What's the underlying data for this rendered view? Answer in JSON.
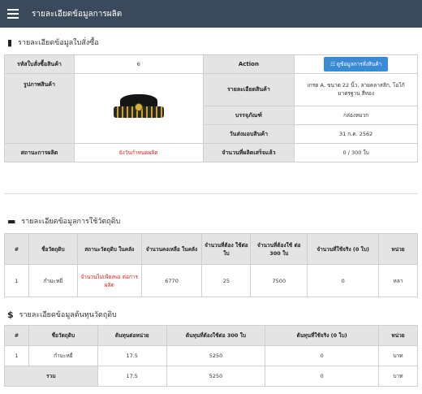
{
  "header": {
    "title": "รายละเอียดข้อมูลการผลิต",
    "menu_icon": "hamburger-icon"
  },
  "order_section": {
    "title": "รายละเอียดข้อมูลใบสั่งซื้อ",
    "icon": "document-icon",
    "order_id_label": "รหัสใบสั่งซื้อสินค้า",
    "order_id_value": "6",
    "action_label": "Action",
    "action_button": "☷ ดูข้อมูลการสั่งสินค้า",
    "image_label": "รูปภาพสินค้า",
    "detail_label": "รายละเอียดสินค้า",
    "detail_value": "เกรด A, ขนาด 22 นิ้ว, ลายคลาสสิก, โอโก้ มาตรฐาน สีทอง",
    "package_label": "บรรจุภัณฑ์",
    "package_value": "กล่องหมวก",
    "delivery_label": "วันส่งมอบสินค้า",
    "delivery_value": "31 ก.ค. 2562",
    "status_label": "สถานะการผลิต",
    "status_value": "ยังวันกำหนดผลิต",
    "produced_label": "จำนวนที่ผลิตเสร็จแล้ว",
    "produced_value": "0 / 300 ใบ"
  },
  "usage_section": {
    "title": "รายละเอียดข้อมูลการใช้วัตถุดิบ",
    "icon": "bed-icon",
    "headers": [
      "#",
      "ชื่อวัตถุดิบ",
      "สถานะวัตถุดิบ ในคลัง",
      "จำนวนคงเหลือ ในคลัง",
      "จำนวนที่ต้อง ใช้ต่อใบ",
      "จำนวนที่ต้องใช้ ต่อ 300 ใบ",
      "จำนวนที่ใช้จริง (0 ใบ)",
      "หน่วย"
    ],
    "rows": [
      [
        "1",
        "กำมะหยี่",
        "จำนวนไม่เพียงพอ ต่อการผลิต",
        "6770",
        "25",
        "7500",
        "0",
        "หลา"
      ]
    ]
  },
  "cost_section": {
    "title": "รายละเอียดข้อมูลต้นทุนวัตถุดิบ",
    "icon": "dollar-icon",
    "headers": [
      "#",
      "ชื่อวัตถุดิบ",
      "ต้นทุนต่อหน่วย",
      "ต้นทุนที่ต้องใช้ต่อ 300 ใบ",
      "ต้นทุนที่ใช้จริง (0 ใบ)",
      "หน่วย"
    ],
    "rows": [
      [
        "1",
        "กำมะหยี่",
        "17.5",
        "5250",
        "0",
        "บาท"
      ]
    ],
    "total_label": "รวม",
    "total_row": [
      "17.5",
      "5250",
      "0",
      "บาท"
    ]
  }
}
